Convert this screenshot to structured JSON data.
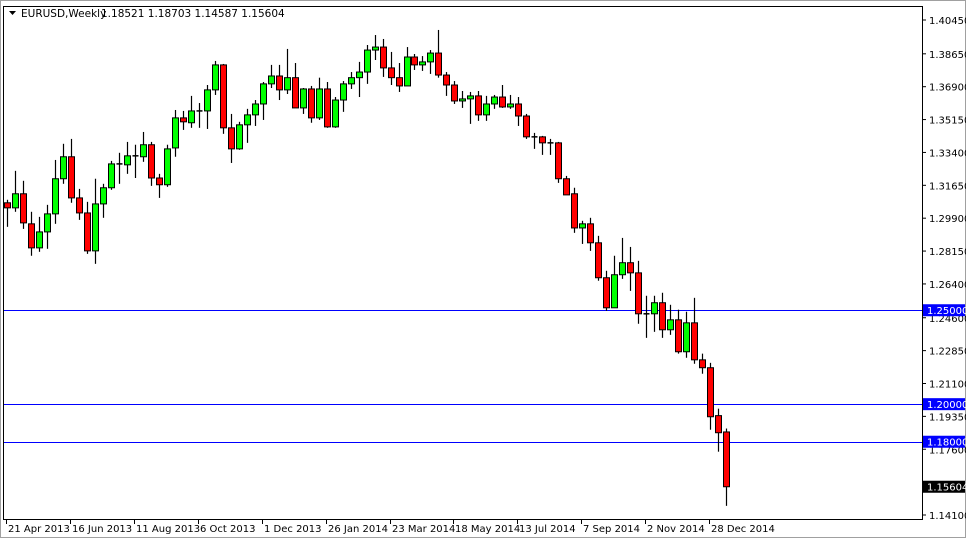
{
  "header": {
    "symbol": "EURUSD,Weekly",
    "ohlc": "1.18521 1.18703 1.14587 1.15604",
    "menu_icon": "triangle-down-icon"
  },
  "colors": {
    "bull": "#00ff00",
    "bear": "#ff0000",
    "outline": "#000000",
    "hline": "#0000ff",
    "price_label_bg": "#000000"
  },
  "chart_data": {
    "type": "candlestick",
    "title": "EURUSD,Weekly",
    "xlabel": "",
    "ylabel": "",
    "ylim": [
      1.141,
      1.4045
    ],
    "grid": false,
    "y_ticks": [
      "1.40450",
      "1.38650",
      "1.36900",
      "1.35150",
      "1.33400",
      "1.31650",
      "1.29900",
      "1.28150",
      "1.26400",
      "1.24600",
      "1.22850",
      "1.21100",
      "1.19350",
      "1.17600",
      "1.14100"
    ],
    "x_labels": [
      {
        "index": 0,
        "label": "21 Apr 2013"
      },
      {
        "index": 8,
        "label": "16 Jun 2013"
      },
      {
        "index": 16,
        "label": "11 Aug 2013"
      },
      {
        "index": 24,
        "label": "6 Oct 2013"
      },
      {
        "index": 32,
        "label": "1 Dec 2013"
      },
      {
        "index": 40,
        "label": "26 Jan 2014"
      },
      {
        "index": 48,
        "label": "23 Mar 2014"
      },
      {
        "index": 56,
        "label": "18 May 2014"
      },
      {
        "index": 64,
        "label": "13 Jul 2014"
      },
      {
        "index": 72,
        "label": "7 Sep 2014"
      },
      {
        "index": 80,
        "label": "2 Nov 2014"
      },
      {
        "index": 88,
        "label": "28 Dec 2014"
      }
    ],
    "horizontal_lines": [
      {
        "price": 1.25,
        "label": "1.25000"
      },
      {
        "price": 1.2,
        "label": "1.20000"
      },
      {
        "price": 1.18,
        "label": "1.18000"
      }
    ],
    "current_price": {
      "price": 1.15604,
      "label": "1.15604"
    },
    "ohlc_fields": [
      "open",
      "high",
      "low",
      "close"
    ],
    "candles": [
      [
        1.3072,
        1.3088,
        1.2944,
        1.3045
      ],
      [
        1.3045,
        1.3242,
        1.3024,
        1.312
      ],
      [
        1.312,
        1.3189,
        1.2933,
        1.2965
      ],
      [
        1.296,
        1.3024,
        1.279,
        1.2832
      ],
      [
        1.2832,
        1.2997,
        1.2811,
        1.2917
      ],
      [
        1.2917,
        1.3061,
        1.2827,
        1.3013
      ],
      [
        1.3013,
        1.33,
        1.296,
        1.32
      ],
      [
        1.32,
        1.3386,
        1.3173,
        1.3317
      ],
      [
        1.3317,
        1.3412,
        1.3072,
        1.3098
      ],
      [
        1.3098,
        1.3146,
        1.2981,
        1.3018
      ],
      [
        1.3018,
        1.3077,
        1.28,
        1.2816
      ],
      [
        1.2816,
        1.32,
        1.2747,
        1.3066
      ],
      [
        1.3066,
        1.3173,
        1.2992,
        1.3152
      ],
      [
        1.3152,
        1.3295,
        1.3141,
        1.3279
      ],
      [
        1.3279,
        1.3338,
        1.3173,
        1.3274
      ],
      [
        1.3274,
        1.3396,
        1.3226,
        1.3322
      ],
      [
        1.3322,
        1.3381,
        1.3204,
        1.3317
      ],
      [
        1.3317,
        1.3449,
        1.329,
        1.3381
      ],
      [
        1.3381,
        1.3396,
        1.3162,
        1.3204
      ],
      [
        1.3204,
        1.3226,
        1.3098,
        1.3168
      ],
      [
        1.3168,
        1.3381,
        1.3157,
        1.3359
      ],
      [
        1.3364,
        1.3566,
        1.3317,
        1.3524
      ],
      [
        1.3524,
        1.3561,
        1.346,
        1.3503
      ],
      [
        1.3498,
        1.3641,
        1.3471,
        1.3561
      ],
      [
        1.3561,
        1.3603,
        1.3471,
        1.3556
      ],
      [
        1.3561,
        1.3699,
        1.3465,
        1.3673
      ],
      [
        1.3673,
        1.3827,
        1.3646,
        1.3806
      ],
      [
        1.3806,
        1.3811,
        1.3439,
        1.3471
      ],
      [
        1.3471,
        1.3545,
        1.3284,
        1.3359
      ],
      [
        1.3359,
        1.3503,
        1.3354,
        1.3487
      ],
      [
        1.3487,
        1.3572,
        1.3391,
        1.354
      ],
      [
        1.354,
        1.3619,
        1.3481,
        1.3598
      ],
      [
        1.3598,
        1.3715,
        1.3513,
        1.3705
      ],
      [
        1.3705,
        1.3806,
        1.3683,
        1.3747
      ],
      [
        1.3747,
        1.3806,
        1.3619,
        1.3673
      ],
      [
        1.3673,
        1.3891,
        1.3651,
        1.3738
      ],
      [
        1.3738,
        1.3816,
        1.3577,
        1.3577
      ],
      [
        1.3577,
        1.3683,
        1.3545,
        1.3678
      ],
      [
        1.3678,
        1.3694,
        1.3498,
        1.3524
      ],
      [
        1.3524,
        1.3738,
        1.3513,
        1.3678
      ],
      [
        1.3678,
        1.3715,
        1.3471,
        1.3476
      ],
      [
        1.3476,
        1.3635,
        1.3471,
        1.3619
      ],
      [
        1.3619,
        1.372,
        1.3556,
        1.3705
      ],
      [
        1.3705,
        1.3768,
        1.3678,
        1.3738
      ],
      [
        1.3738,
        1.3822,
        1.3635,
        1.3768
      ],
      [
        1.3768,
        1.3912,
        1.3705,
        1.3885
      ],
      [
        1.3885,
        1.3965,
        1.3832,
        1.3901
      ],
      [
        1.3901,
        1.3944,
        1.3742,
        1.379
      ],
      [
        1.379,
        1.3875,
        1.3699,
        1.3738
      ],
      [
        1.3738,
        1.3816,
        1.3662,
        1.3694
      ],
      [
        1.3694,
        1.3901,
        1.3694,
        1.3848
      ],
      [
        1.3848,
        1.3864,
        1.3779,
        1.3806
      ],
      [
        1.3806,
        1.3853,
        1.3774,
        1.3822
      ],
      [
        1.3822,
        1.3885,
        1.3758,
        1.3869
      ],
      [
        1.3869,
        1.3992,
        1.3738,
        1.3752
      ],
      [
        1.3752,
        1.3768,
        1.3641,
        1.3699
      ],
      [
        1.3699,
        1.372,
        1.3598,
        1.3614
      ],
      [
        1.3614,
        1.3667,
        1.3577,
        1.3625
      ],
      [
        1.3625,
        1.3662,
        1.3492,
        1.3641
      ],
      [
        1.3641,
        1.3667,
        1.3508,
        1.354
      ],
      [
        1.354,
        1.3641,
        1.3508,
        1.3598
      ],
      [
        1.3598,
        1.3646,
        1.3572,
        1.3635
      ],
      [
        1.3635,
        1.3699,
        1.3577,
        1.3582
      ],
      [
        1.3582,
        1.3646,
        1.3572,
        1.3598
      ],
      [
        1.3598,
        1.3635,
        1.3481,
        1.3534
      ],
      [
        1.3534,
        1.3545,
        1.3412,
        1.3423
      ],
      [
        1.3423,
        1.3444,
        1.3359,
        1.3418
      ],
      [
        1.3423,
        1.3428,
        1.3327,
        1.3391
      ],
      [
        1.3391,
        1.3412,
        1.3327,
        1.3386
      ],
      [
        1.3391,
        1.3396,
        1.3178,
        1.32
      ],
      [
        1.32,
        1.3215,
        1.3114,
        1.3114
      ],
      [
        1.312,
        1.3152,
        1.2912,
        1.2938
      ],
      [
        1.2938,
        1.2976,
        1.2853,
        1.296
      ],
      [
        1.296,
        1.2992,
        1.2816,
        1.2859
      ],
      [
        1.2859,
        1.2896,
        1.2657,
        1.2673
      ],
      [
        1.2673,
        1.271,
        1.2497,
        1.2513
      ],
      [
        1.2513,
        1.279,
        1.2513,
        1.2689
      ],
      [
        1.2689,
        1.2885,
        1.2667,
        1.2753
      ],
      [
        1.2753,
        1.2837,
        1.2603,
        1.2699
      ],
      [
        1.2699,
        1.2763,
        1.2428,
        1.2481
      ],
      [
        1.2481,
        1.2577,
        1.2353,
        1.2476
      ],
      [
        1.2481,
        1.2577,
        1.2385,
        1.254
      ],
      [
        1.254,
        1.2593,
        1.2353,
        1.2396
      ],
      [
        1.2396,
        1.2529,
        1.2369,
        1.2449
      ],
      [
        1.2449,
        1.2503,
        1.2269,
        1.2279
      ],
      [
        1.2279,
        1.2492,
        1.2247,
        1.2433
      ],
      [
        1.2433,
        1.2566,
        1.2215,
        1.2236
      ],
      [
        1.2236,
        1.2269,
        1.2162,
        1.2194
      ],
      [
        1.2194,
        1.222,
        1.1864,
        1.1933
      ],
      [
        1.1939,
        1.1976,
        1.1747,
        1.1848
      ],
      [
        1.18521,
        1.18703,
        1.14587,
        1.15604
      ]
    ]
  }
}
